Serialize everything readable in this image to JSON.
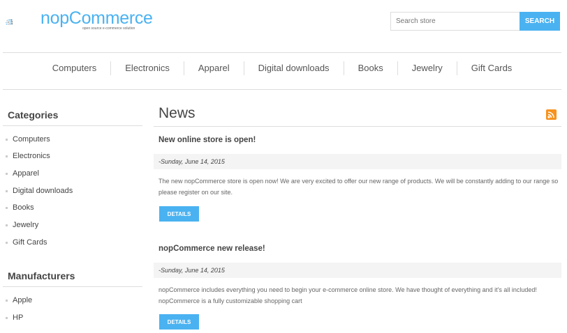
{
  "header": {
    "logo_text": "nopCommerce",
    "logo_tagline": "open source e-commerce solution",
    "search_placeholder": "Search store",
    "search_button": "SEARCH"
  },
  "nav": [
    "Computers",
    "Electronics",
    "Apparel",
    "Digital downloads",
    "Books",
    "Jewelry",
    "Gift Cards"
  ],
  "sidebar": {
    "categories_title": "Categories",
    "categories": [
      "Computers",
      "Electronics",
      "Apparel",
      "Digital downloads",
      "Books",
      "Jewelry",
      "Gift Cards"
    ],
    "manufacturers_title": "Manufacturers",
    "manufacturers": [
      "Apple",
      "HP"
    ]
  },
  "main": {
    "title": "News",
    "rss_icon": "rss-icon",
    "articles": [
      {
        "title": "New online store is open!",
        "date": "-Sunday, June 14, 2015",
        "body": "The new nopCommerce store is open now! We are very excited to offer our new range of products. We will be constantly adding to our range so please register on our site.",
        "button": "DETAILS"
      },
      {
        "title": "nopCommerce new release!",
        "date": "-Sunday, June 14, 2015",
        "body": "nopCommerce includes everything you need to begin your e-commerce online store. We have thought of everything and it's all included! nopCommerce is a fully customizable shopping cart",
        "button": "DETAILS"
      }
    ]
  },
  "colors": {
    "accent": "#4ab2f1",
    "rss": "#f7931e"
  }
}
